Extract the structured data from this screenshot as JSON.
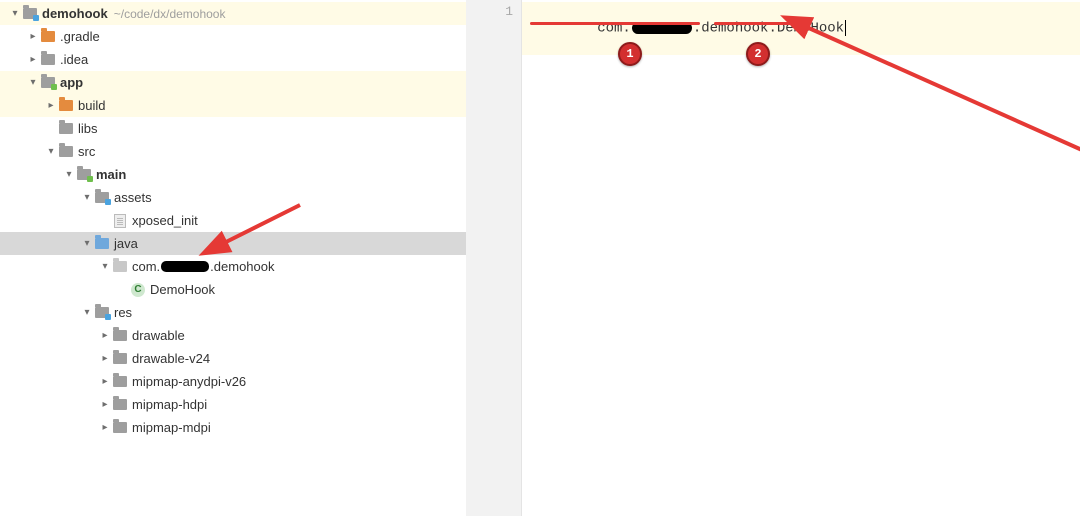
{
  "tree": {
    "root": {
      "name": "demohook",
      "path": "~/code/dx/demohook"
    },
    "gradle": ".gradle",
    "idea": ".idea",
    "app": "app",
    "build": "build",
    "libs": "libs",
    "src": "src",
    "main": "main",
    "assets": "assets",
    "xposed_init": "xposed_init",
    "java": "java",
    "pkg_pre": "com.",
    "pkg_post": ".demohook",
    "demoHook": "DemoHook",
    "res": "res",
    "drawable": "drawable",
    "drawable_v24": "drawable-v24",
    "mipmap_anydpi_v26": "mipmap-anydpi-v26",
    "mipmap_hdpi": "mipmap-hdpi",
    "mipmap_mdpi": "mipmap-mdpi"
  },
  "editor": {
    "line_no": "1",
    "seg1": "com.",
    "seg2": ".demohook.",
    "seg3": "DemoHook"
  },
  "callouts": {
    "one": "1",
    "two": "2"
  },
  "icons": {
    "class_letter": "C"
  }
}
